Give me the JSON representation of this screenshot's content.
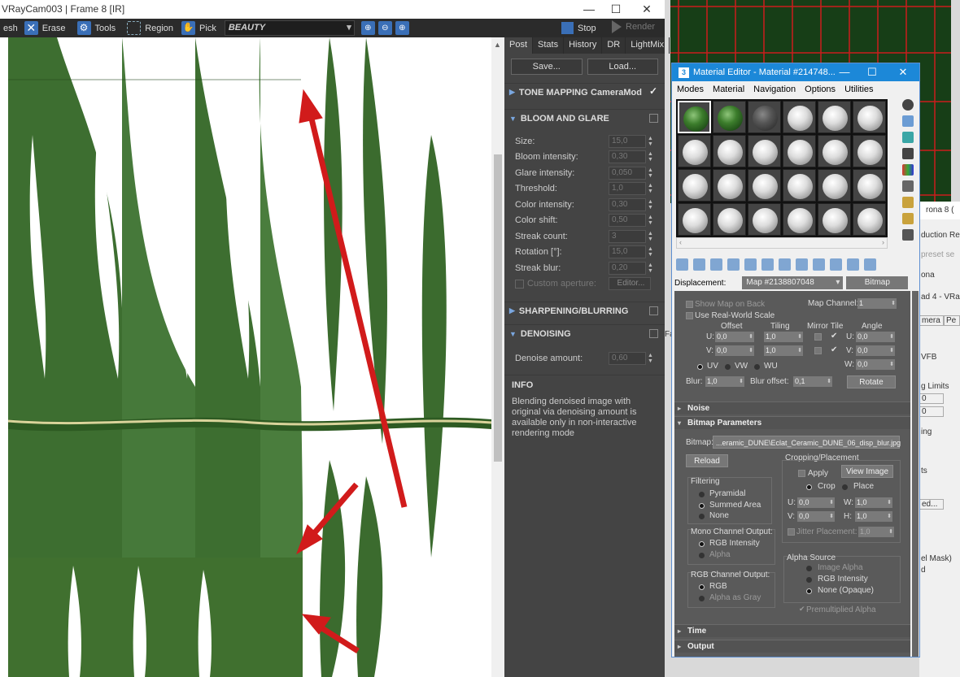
{
  "vfb": {
    "title": "VRayCam003 | Frame 8 [IR]",
    "toolbar": {
      "refresh": "esh",
      "erase": "Erase",
      "tools": "Tools",
      "region": "Region",
      "pick": "Pick",
      "channel": "BEAUTY",
      "stop": "Stop",
      "render": "Render"
    },
    "tabs": [
      "Post",
      "Stats",
      "History",
      "DR",
      "LightMix"
    ],
    "save": "Save...",
    "load": "Load...",
    "tone_mapping": {
      "label": "TONE MAPPING",
      "value": "CameraMod",
      "check": "✓"
    },
    "bloom": {
      "label": "BLOOM AND GLARE",
      "rows": [
        {
          "label": "Size:",
          "value": "15,0"
        },
        {
          "label": "Bloom intensity:",
          "value": "0,30"
        },
        {
          "label": "Glare intensity:",
          "value": "0,050"
        },
        {
          "label": "Threshold:",
          "value": "1,0"
        },
        {
          "label": "Color intensity:",
          "value": "0,30"
        },
        {
          "label": "Color shift:",
          "value": "0,50"
        },
        {
          "label": "Streak count:",
          "value": "3"
        },
        {
          "label": "Rotation [°]:",
          "value": "15,0"
        },
        {
          "label": "Streak blur:",
          "value": "0,20"
        }
      ],
      "custom_aperture": "Custom aperture:",
      "editor": "Editor..."
    },
    "sharpening": "SHARPENING/BLURRING",
    "denoising": {
      "label": "DENOISING",
      "amount_label": "Denoise amount:",
      "amount_value": "0,60"
    },
    "info": {
      "title": "INFO",
      "text": "Blending denoised image with original via denoising amount is available only in non-interactive rendering mode"
    }
  },
  "material_editor": {
    "title": "Material Editor - Material #214748...",
    "menu": [
      "Modes",
      "Material",
      "Navigation",
      "Options",
      "Utilities"
    ],
    "displacement_label": "Displacement:",
    "map_name": "Map #2138807048",
    "map_type": "Bitmap",
    "coords": {
      "show_map_on_back": "Show Map on Back",
      "use_real_world": "Use Real-World Scale",
      "map_channel_label": "Map Channel:",
      "map_channel": "1",
      "offset": "Offset",
      "tiling": "Tiling",
      "mirror_tile": "Mirror Tile",
      "angle": "Angle",
      "u_label": "U:",
      "v_label": "V:",
      "w_label": "W:",
      "u_offset": "0,0",
      "v_offset": "0,0",
      "u_tiling": "1,0",
      "v_tiling": "1,0",
      "u_angle": "0,0",
      "v_angle": "0,0",
      "w_angle": "0,0",
      "check": "✔",
      "uv": "UV",
      "vw": "VW",
      "wu": "WU",
      "blur_label": "Blur:",
      "blur": "1,0",
      "blur_offset_label": "Blur offset:",
      "blur_offset": "0,1",
      "rotate": "Rotate"
    },
    "noise": "Noise",
    "bitmap_params": "Bitmap Parameters",
    "bitmap_label": "Bitmap:",
    "bitmap_path": "...eramic_DUNE\\Eclat_Ceramic_DUNE_06_disp_blur.jpg",
    "reload": "Reload",
    "cropping": {
      "title": "Cropping/Placement",
      "apply": "Apply",
      "view_image": "View Image",
      "crop": "Crop",
      "place": "Place",
      "u": "0,0",
      "v": "0,0",
      "w": "1,0",
      "h": "1,0",
      "h_label": "H:",
      "jitter": "Jitter Placement:",
      "jitter_value": "1,0"
    },
    "filtering": {
      "title": "Filtering",
      "options": [
        "Pyramidal",
        "Summed Area",
        "None"
      ]
    },
    "mono": {
      "title": "Mono Channel Output:",
      "options": [
        "RGB Intensity",
        "Alpha"
      ]
    },
    "rgb_out": {
      "title": "RGB Channel Output:",
      "options": [
        "RGB",
        "Alpha as Gray"
      ]
    },
    "alpha_source": {
      "title": "Alpha Source",
      "options": [
        "Image Alpha",
        "RGB Intensity",
        "None (Opaque)"
      ]
    },
    "premultiplied": "Premultiplied Alpha",
    "time": "Time",
    "output": "Output"
  },
  "behind_window": {
    "title": "rona 8 (",
    "items": [
      "duction Re",
      "preset se",
      "ona",
      "ad 4 - VRa",
      "mera",
      "Pe",
      "VFB",
      "g Limits",
      "0",
      "0",
      "ing",
      "ts",
      "ed...",
      "el Mask)",
      "d"
    ]
  },
  "viewport_label": "Fa"
}
